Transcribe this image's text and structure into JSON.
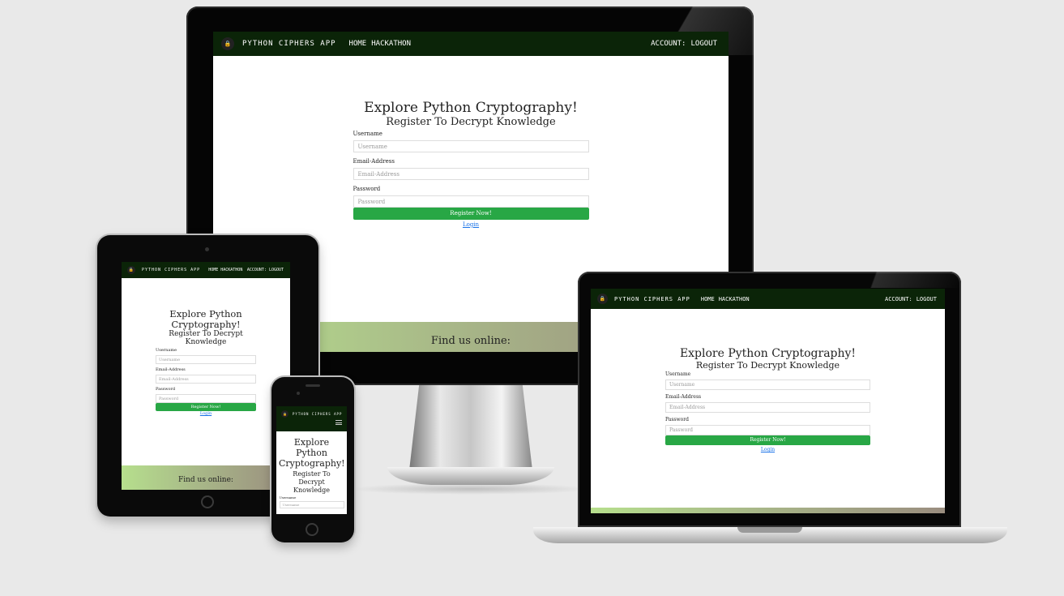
{
  "site": {
    "brand": "PYTHON CIPHERS APP",
    "nav_links": [
      "HOME",
      "HACKATHON"
    ],
    "nav_right": [
      "ACCOUNT:",
      "LOGOUT"
    ],
    "heading": "Explore Python Cryptography!",
    "subheading": "Register To Decrypt Knowledge",
    "username_label": "Username",
    "username_placeholder": "Username",
    "email_label": "Email-Address",
    "email_placeholder": "Email-Address",
    "password_label": "Password",
    "password_placeholder": "Password",
    "register_button": "Register Now!",
    "login_link": "Login",
    "footer_text": "Find us online:"
  },
  "colors": {
    "navbar": "#0b2408",
    "button": "#28a745",
    "link": "#1a73e8",
    "footer_gradient_start": "#b6df8d",
    "footer_gradient_end": "#9a8d7f",
    "background": "#e9e9e9"
  },
  "devices": [
    "desktop-monitor",
    "tablet",
    "phone",
    "laptop"
  ]
}
